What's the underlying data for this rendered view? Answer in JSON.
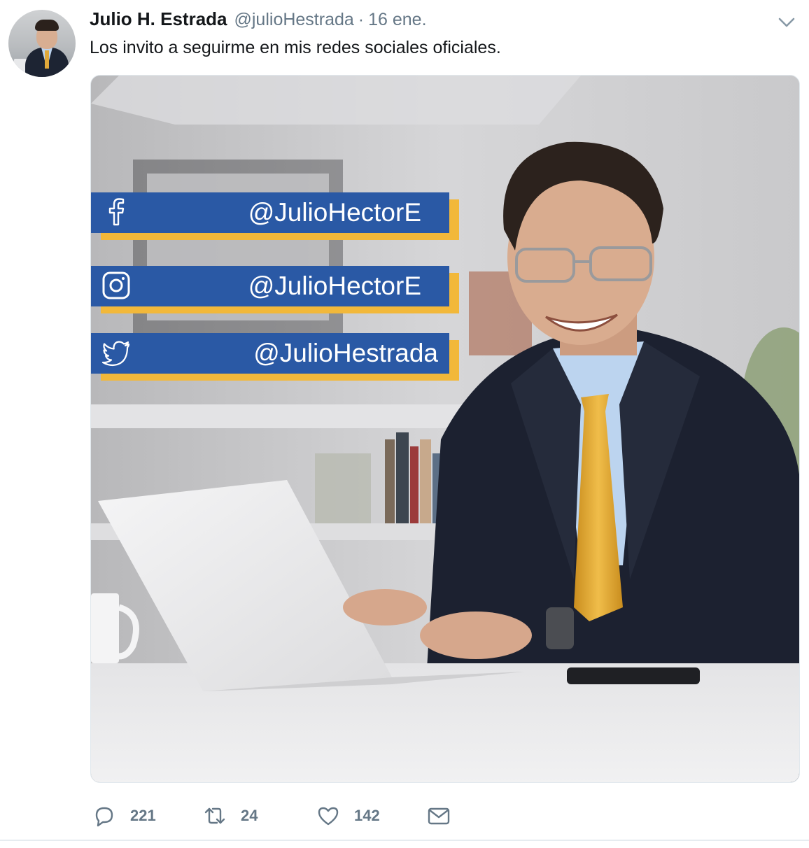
{
  "tweet": {
    "author_name": "Julio H. Estrada",
    "handle": "@julioHestrada",
    "separator": "·",
    "time": "16 ene.",
    "text": "Los invito a seguirme en mis redes sociales oficiales."
  },
  "image": {
    "social_labels": [
      {
        "network": "facebook",
        "icon": "facebook-icon",
        "handle": "@JulioHectorE"
      },
      {
        "network": "instagram",
        "icon": "instagram-icon",
        "handle": "@JulioHectorE"
      },
      {
        "network": "twitter",
        "icon": "twitter-icon",
        "handle": "@JulioHestrada"
      }
    ],
    "colors": {
      "banner_blue": "#2a59a5",
      "banner_accent": "#f2b83a",
      "tie": "#e0a52e",
      "suit": "#1c2130"
    }
  },
  "actions": {
    "replies": "221",
    "retweets": "24",
    "likes": "142"
  },
  "colors": {
    "text": "#14171a",
    "muted": "#657786"
  }
}
